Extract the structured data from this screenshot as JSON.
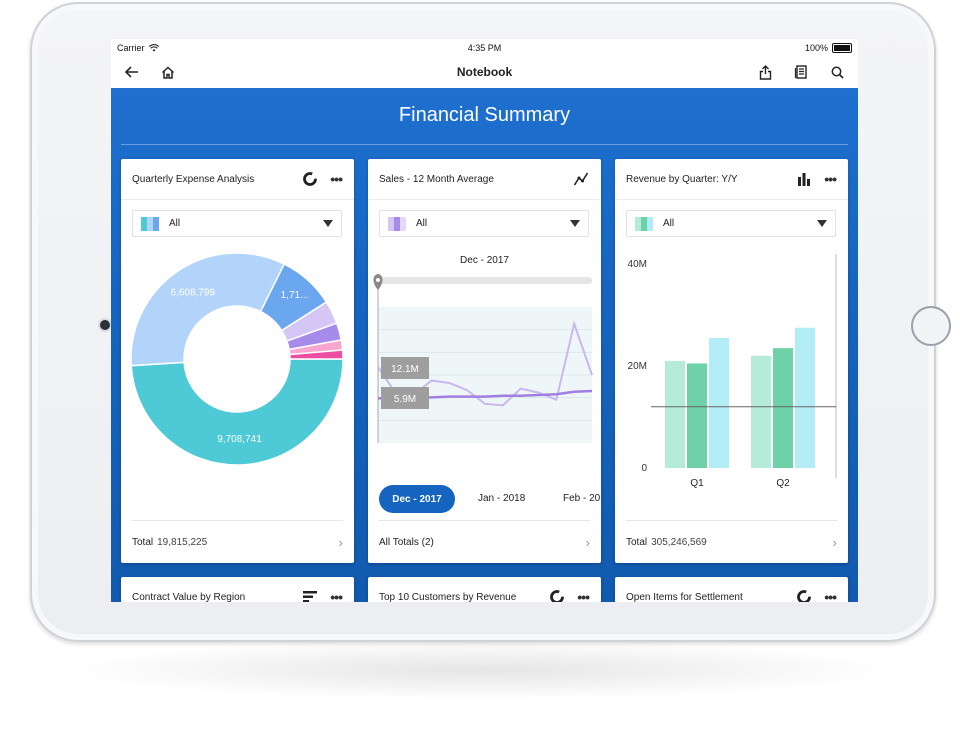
{
  "status_bar": {
    "carrier": "Carrier",
    "time": "4:35 PM",
    "battery": "100%"
  },
  "nav": {
    "title": "Notebook"
  },
  "header": {
    "title": "Financial Summary"
  },
  "cards": [
    {
      "title": "Quarterly Expense Analysis",
      "filter": "All",
      "footer_label": "Total",
      "footer_value": "19,815,225",
      "colors": {
        "teal": "#4ec9d6",
        "light_blue": "#b3d4fa",
        "blue": "#6aa7ee",
        "lavender": "#d4c6f5",
        "purple": "#a78bea",
        "pink": "#f7a6cf",
        "magenta": "#ec4ea2"
      }
    },
    {
      "title": "Sales - 12 Month Average",
      "filter": "All",
      "selected_period": "Dec - 2017",
      "tooltip_high": "12.1M",
      "tooltip_low": "5.9M",
      "periods": [
        "Dec - 2017",
        "Jan - 2018",
        "Feb - 20"
      ],
      "footer_label": "All Totals (2)"
    },
    {
      "title": "Revenue by Quarter: Y/Y",
      "filter": "All",
      "footer_label": "Total",
      "footer_value": "305,246,569"
    }
  ],
  "bottom_cards": [
    {
      "title": "Contract Value by Region"
    },
    {
      "title": "Top 10 Customers by Revenue"
    },
    {
      "title": "Open Items for Settlement"
    }
  ],
  "chart_data": [
    {
      "type": "pie",
      "title": "Quarterly Expense Analysis",
      "labels": [
        "6,608,799",
        "1,71...",
        "9,708,741"
      ],
      "values": [
        9708741,
        6608799,
        1710000,
        700000,
        520000,
        300000,
        267685
      ],
      "colors": [
        "#4ec9d6",
        "#b3d4fa",
        "#6aa7ee",
        "#d4c6f5",
        "#a78bea",
        "#f7a6cf",
        "#ec4ea2"
      ]
    },
    {
      "type": "line",
      "title": "Sales - 12 Month Average",
      "series": [
        {
          "values": [
            9.5,
            6.2,
            6.0,
            7.8,
            7.5,
            6.6,
            4.9,
            4.7,
            6.8,
            6.3,
            5.4,
            14.9,
            8.5
          ]
        },
        {
          "values": [
            5.6,
            5.6,
            5.7,
            5.7,
            5.8,
            5.8,
            5.8,
            5.9,
            5.9,
            6.0,
            6.1,
            6.4,
            6.5
          ]
        }
      ]
    },
    {
      "type": "bar",
      "title": "Revenue by Quarter: Y/Y",
      "categories": [
        "Q1",
        "Q2"
      ],
      "series": [
        {
          "values": [
            21,
            22
          ]
        },
        {
          "values": [
            20.5,
            23.5
          ]
        },
        {
          "values": [
            25.5,
            27.5
          ]
        }
      ],
      "series_colors": [
        "#b5ebd9",
        "#6fd1a8",
        "#b2ecf4"
      ],
      "y_ticks": [
        "0",
        "20M",
        "40M"
      ],
      "ylim": [
        0,
        40
      ],
      "reference_value": 12
    }
  ]
}
